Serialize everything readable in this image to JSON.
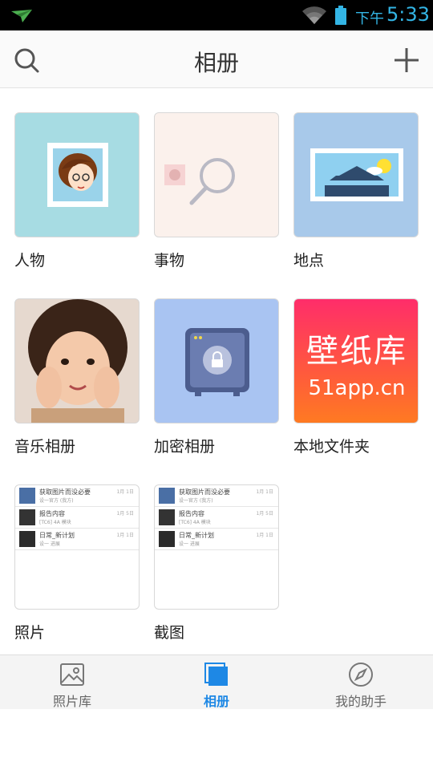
{
  "status_bar": {
    "ampm": "下午",
    "time": "5:33"
  },
  "app_bar": {
    "title": "相册"
  },
  "albums": [
    {
      "label": "人物"
    },
    {
      "label": "事物"
    },
    {
      "label": "地点"
    },
    {
      "label": "音乐相册"
    },
    {
      "label": "加密相册"
    },
    {
      "label": "本地文件夹",
      "thumb_text_line1": "壁纸库",
      "thumb_text_line2": "51app.cn"
    },
    {
      "label": "照片"
    },
    {
      "label": "截图"
    }
  ],
  "mini_list": [
    {
      "title": "获取图片而没必要",
      "sub": "设一官方 (我方)",
      "date": "1月 1日"
    },
    {
      "title": "报告内容",
      "sub": "[TC6] 4A 模块",
      "date": "1月 5日"
    },
    {
      "title": "日常_新计划",
      "sub": "设一 进展",
      "date": "1月 1日"
    }
  ],
  "bottom_nav": [
    {
      "label": "照片库",
      "icon": "image-icon",
      "active": false
    },
    {
      "label": "相册",
      "icon": "album-icon",
      "active": true
    },
    {
      "label": "我的助手",
      "icon": "compass-icon",
      "active": false
    }
  ],
  "colors": {
    "accent": "#1e88e5",
    "status": "#33b5e5"
  }
}
